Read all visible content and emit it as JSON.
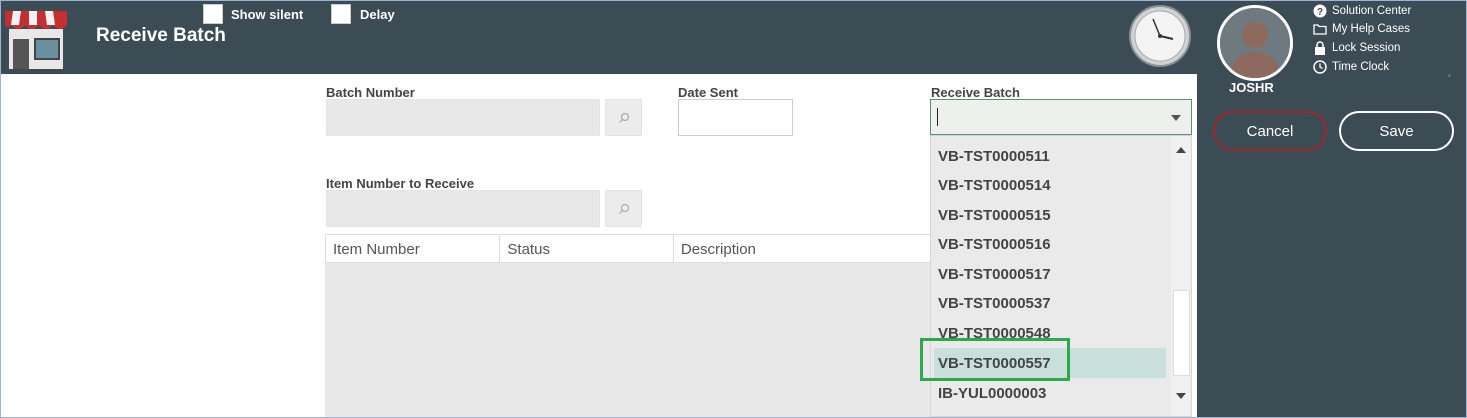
{
  "header": {
    "title": "Receive Batch",
    "show_silent_label": "Show silent",
    "delay_label": "Delay"
  },
  "user": {
    "name": "JOSHR"
  },
  "help_menu": [
    {
      "label": "Solution Center",
      "icon": "question-circle-icon"
    },
    {
      "label": "My Help Cases",
      "icon": "folder-icon"
    },
    {
      "label": "Lock Session",
      "icon": "lock-icon"
    },
    {
      "label": "Time Clock",
      "icon": "clock-icon"
    }
  ],
  "actions": {
    "cancel_label": "Cancel",
    "save_label": "Save"
  },
  "form": {
    "batch_number_label": "Batch Number",
    "batch_number_value": "",
    "date_sent_label": "Date Sent",
    "date_sent_value": "",
    "receive_batch_label": "Receive Batch",
    "receive_batch_value": "",
    "item_number_label": "Item Number to Receive",
    "item_number_value": ""
  },
  "grid": {
    "columns": [
      "Item Number",
      "Status",
      "Description"
    ]
  },
  "dropdown": {
    "items": [
      "VB-TST0000511",
      "VB-TST0000514",
      "VB-TST0000515",
      "VB-TST0000516",
      "VB-TST0000517",
      "VB-TST0000537",
      "VB-TST0000548",
      "VB-TST0000557",
      "IB-YUL0000003"
    ],
    "selected": "VB-TST0000557"
  },
  "colors": {
    "header_bg": "#3b4c55",
    "cancel_border": "#a2262a",
    "highlight": "#2ea84a",
    "selected_row": "#c9dfdb"
  }
}
